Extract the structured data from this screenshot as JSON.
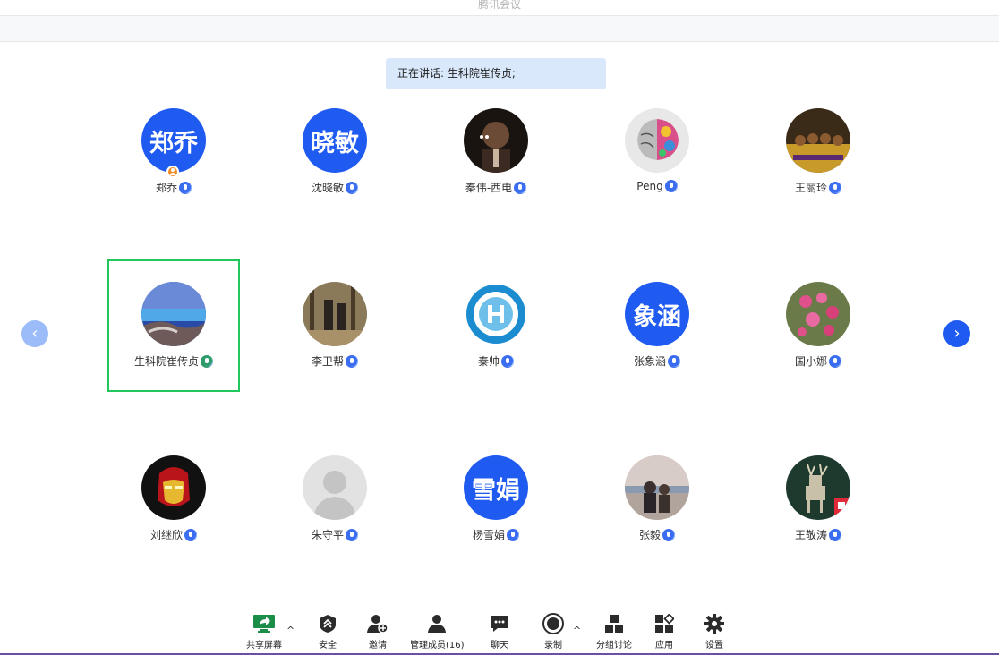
{
  "window": {
    "title": "腾讯会议"
  },
  "speaking": {
    "text": "正在讲话: 生科院崔传贞;"
  },
  "participants": [
    {
      "name": "郑乔",
      "avatar_text": "郑乔",
      "avatar_kind": "text",
      "host": true
    },
    {
      "name": "沈晓敏",
      "avatar_text": "晓敏",
      "avatar_kind": "text"
    },
    {
      "name": "秦伟-西电",
      "avatar_kind": "photo-portrait"
    },
    {
      "name": "Peng",
      "avatar_kind": "photo-colorful-brain"
    },
    {
      "name": "王丽玲",
      "avatar_kind": "photo-team"
    },
    {
      "name": "生科院崔传贞",
      "avatar_kind": "photo-lake",
      "speaking": true
    },
    {
      "name": "李卫帮",
      "avatar_kind": "photo-forest"
    },
    {
      "name": "秦帅",
      "avatar_kind": "logo-university"
    },
    {
      "name": "张象涵",
      "avatar_text": "象涵",
      "avatar_kind": "text"
    },
    {
      "name": "国小娜",
      "avatar_kind": "photo-flowers"
    },
    {
      "name": "刘继欣",
      "avatar_kind": "photo-iron-mask"
    },
    {
      "name": "朱守平",
      "avatar_kind": "default-silhouette"
    },
    {
      "name": "杨雪娟",
      "avatar_text": "雪娟",
      "avatar_kind": "text"
    },
    {
      "name": "张毅",
      "avatar_kind": "photo-couple-sea"
    },
    {
      "name": "王敬涛",
      "avatar_kind": "photo-deer"
    }
  ],
  "toolbar": {
    "share": "共享屏幕",
    "security": "安全",
    "invite": "邀请",
    "members": "管理成员(16)",
    "chat": "聊天",
    "record": "录制",
    "breakout": "分组讨论",
    "apps": "应用",
    "settings": "设置"
  },
  "colors": {
    "accent": "#1f5bf0",
    "speaking_frame": "#21c65c",
    "speaking_banner": "#dae8fc"
  }
}
